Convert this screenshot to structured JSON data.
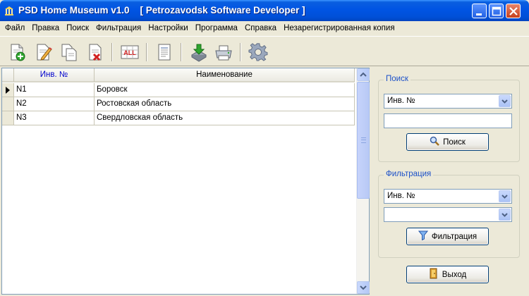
{
  "window": {
    "title": "PSD Home Museum v1.0    [ Petrozavodsk Software Developer ]"
  },
  "menu": {
    "items": [
      "Файл",
      "Правка",
      "Поиск",
      "Фильтрация",
      "Настройки",
      "Программа",
      "Справка",
      "Незарегистрированная копия"
    ]
  },
  "toolbar": {
    "icons": [
      "add-document-icon",
      "edit-document-icon",
      "copy-document-icon",
      "delete-document-icon",
      "select-all-icon",
      "report-icon",
      "import-icon",
      "print-icon",
      "settings-gear-icon"
    ],
    "select_all_text": "ALL"
  },
  "grid": {
    "columns": [
      "Инв. №",
      "Наименование"
    ],
    "rows": [
      {
        "inv": "N1",
        "name": "Боровск"
      },
      {
        "inv": "N2",
        "name": "Ростовская область"
      },
      {
        "inv": "N3",
        "name": "Свердловская область"
      }
    ],
    "selected_row": 0
  },
  "search": {
    "title": "Поиск",
    "field_value": "Инв. №",
    "text_value": "",
    "button_label": "Поиск"
  },
  "filter": {
    "title": "Фильтрация",
    "field_value": "Инв. №",
    "value_value": "",
    "button_label": "Фильтрация"
  },
  "exit": {
    "button_label": "Выход"
  },
  "colors": {
    "titlebar": "#0054e3",
    "window_bg": "#ece9d8",
    "group_title": "#1b50c8",
    "header_accent": "#0000cc"
  }
}
